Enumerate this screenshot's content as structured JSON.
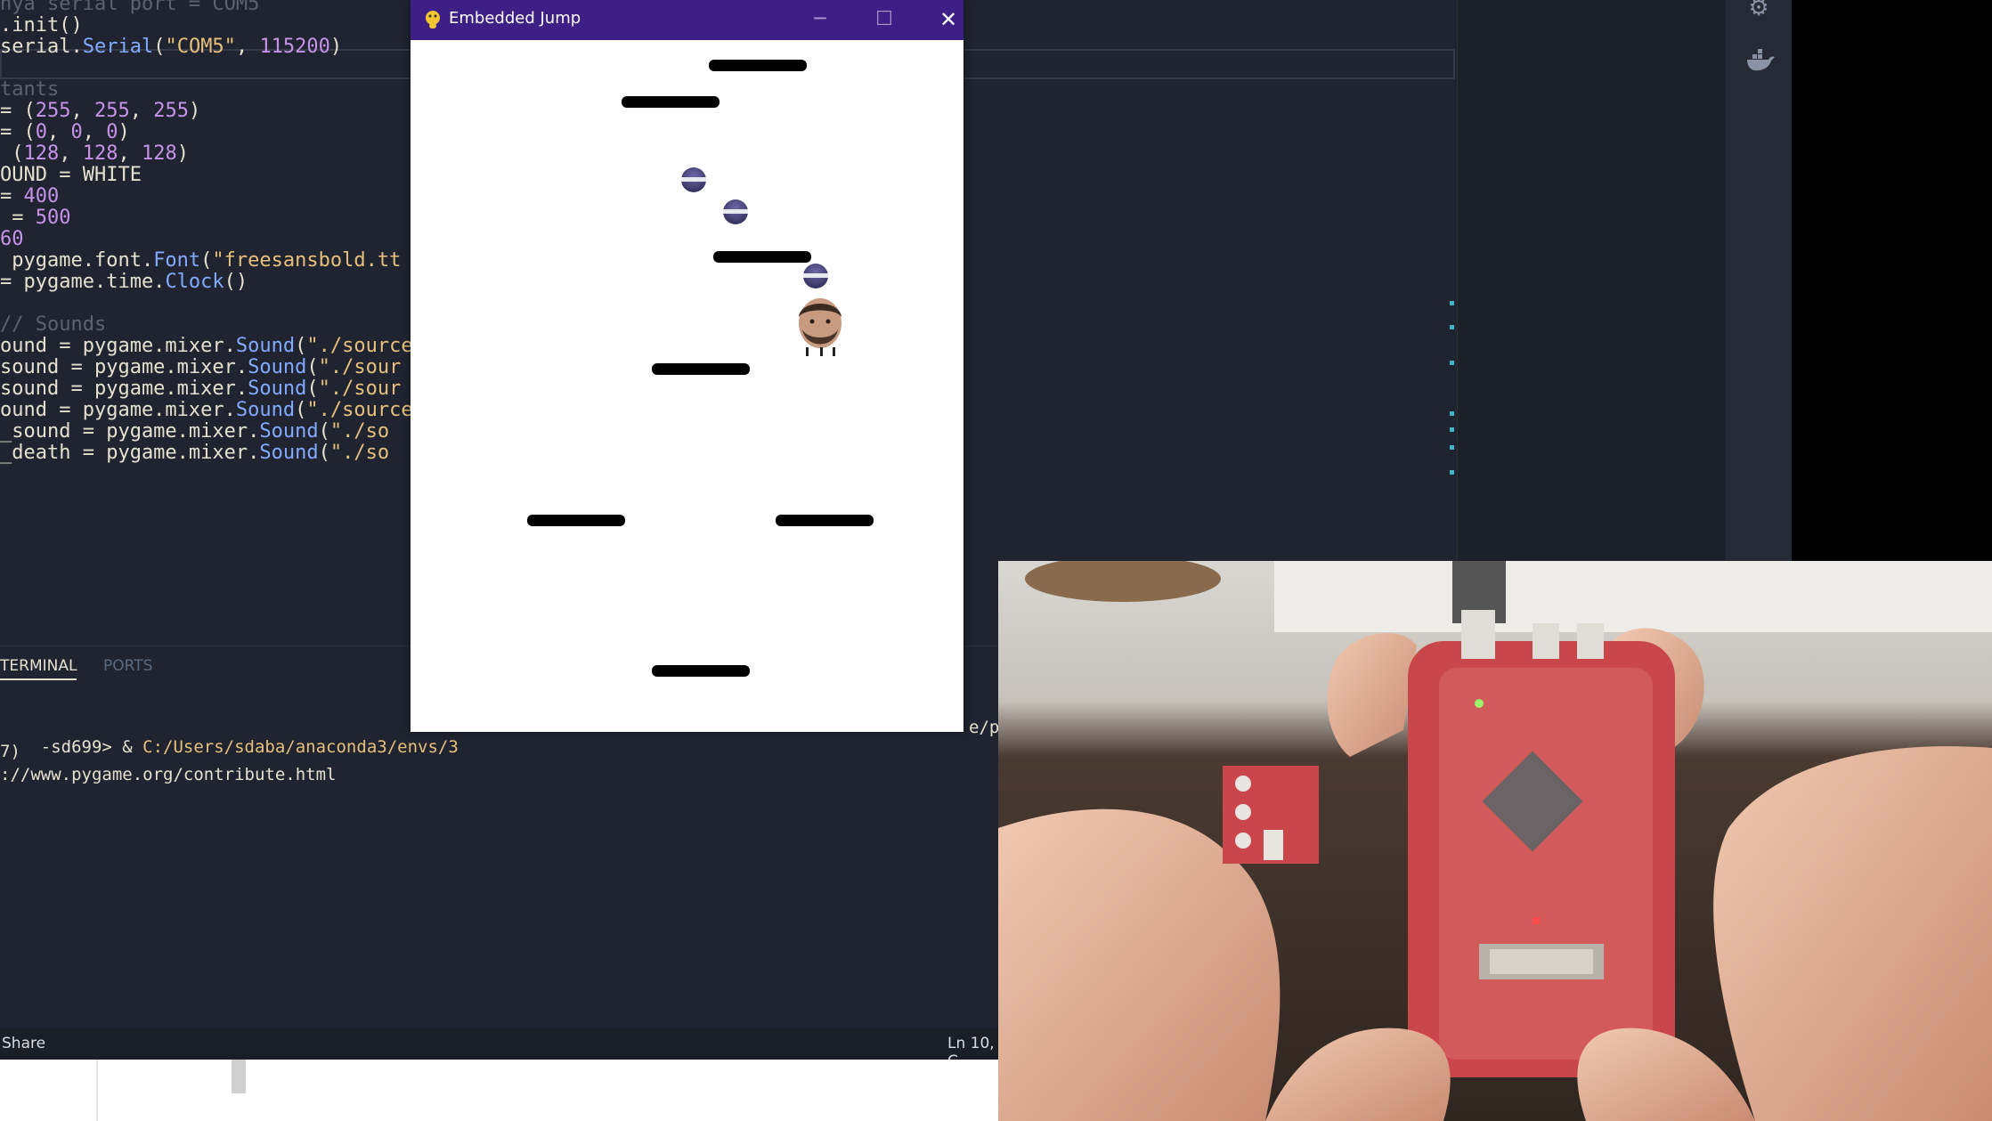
{
  "editor": {
    "code_lines": [
      {
        "parts": [
          {
            "t": "nya serial port = COM5",
            "c": "c-com"
          }
        ]
      },
      {
        "parts": [
          {
            "t": ".init()",
            "c": ""
          }
        ]
      },
      {
        "parts": [
          {
            "t": "serial.",
            "c": ""
          },
          {
            "t": "Serial",
            "c": "c-fn"
          },
          {
            "t": "(",
            "c": ""
          },
          {
            "t": "\"COM5\"",
            "c": "c-str"
          },
          {
            "t": ", ",
            "c": ""
          },
          {
            "t": "115200",
            "c": "c-num"
          },
          {
            "t": ")",
            "c": ""
          }
        ]
      },
      {
        "parts": [
          {
            "t": "",
            "c": ""
          }
        ]
      },
      {
        "parts": [
          {
            "t": "tants",
            "c": "c-com"
          }
        ]
      },
      {
        "parts": [
          {
            "t": "= (",
            "c": ""
          },
          {
            "t": "255",
            "c": "c-num"
          },
          {
            "t": ", ",
            "c": ""
          },
          {
            "t": "255",
            "c": "c-num"
          },
          {
            "t": ", ",
            "c": ""
          },
          {
            "t": "255",
            "c": "c-num"
          },
          {
            "t": ")",
            "c": ""
          }
        ]
      },
      {
        "parts": [
          {
            "t": "= (",
            "c": ""
          },
          {
            "t": "0",
            "c": "c-num"
          },
          {
            "t": ", ",
            "c": ""
          },
          {
            "t": "0",
            "c": "c-num"
          },
          {
            "t": ", ",
            "c": ""
          },
          {
            "t": "0",
            "c": "c-num"
          },
          {
            "t": ")",
            "c": ""
          }
        ]
      },
      {
        "parts": [
          {
            "t": " (",
            "c": ""
          },
          {
            "t": "128",
            "c": "c-num"
          },
          {
            "t": ", ",
            "c": ""
          },
          {
            "t": "128",
            "c": "c-num"
          },
          {
            "t": ", ",
            "c": ""
          },
          {
            "t": "128",
            "c": "c-num"
          },
          {
            "t": ")",
            "c": ""
          }
        ]
      },
      {
        "parts": [
          {
            "t": "OUND = WHITE",
            "c": ""
          }
        ]
      },
      {
        "parts": [
          {
            "t": "= ",
            "c": ""
          },
          {
            "t": "400",
            "c": "c-num"
          }
        ]
      },
      {
        "parts": [
          {
            "t": " = ",
            "c": ""
          },
          {
            "t": "500",
            "c": "c-num"
          }
        ]
      },
      {
        "parts": [
          {
            "t": "60",
            "c": "c-num"
          }
        ]
      },
      {
        "parts": [
          {
            "t": " pygame.font.",
            "c": ""
          },
          {
            "t": "Font",
            "c": "c-fn"
          },
          {
            "t": "(",
            "c": ""
          },
          {
            "t": "\"freesansbold.tt",
            "c": "c-str"
          }
        ]
      },
      {
        "parts": [
          {
            "t": "= pygame.time.",
            "c": ""
          },
          {
            "t": "Clock",
            "c": "c-fn"
          },
          {
            "t": "()",
            "c": ""
          }
        ]
      },
      {
        "parts": [
          {
            "t": "",
            "c": ""
          }
        ]
      },
      {
        "parts": [
          {
            "t": "// Sounds",
            "c": "c-com"
          }
        ]
      },
      {
        "parts": [
          {
            "t": "ound = pygame.mixer.",
            "c": ""
          },
          {
            "t": "Sound",
            "c": "c-fn"
          },
          {
            "t": "(",
            "c": ""
          },
          {
            "t": "\"./source",
            "c": "c-str"
          }
        ]
      },
      {
        "parts": [
          {
            "t": "sound = pygame.mixer.",
            "c": ""
          },
          {
            "t": "Sound",
            "c": "c-fn"
          },
          {
            "t": "(",
            "c": ""
          },
          {
            "t": "\"./sour",
            "c": "c-str"
          }
        ]
      },
      {
        "parts": [
          {
            "t": "sound = pygame.mixer.",
            "c": ""
          },
          {
            "t": "Sound",
            "c": "c-fn"
          },
          {
            "t": "(",
            "c": ""
          },
          {
            "t": "\"./sour",
            "c": "c-str"
          }
        ]
      },
      {
        "parts": [
          {
            "t": "ound = pygame.mixer.",
            "c": ""
          },
          {
            "t": "Sound",
            "c": "c-fn"
          },
          {
            "t": "(",
            "c": ""
          },
          {
            "t": "\"./source",
            "c": "c-str"
          }
        ]
      },
      {
        "parts": [
          {
            "t": "_sound = pygame.mixer.",
            "c": ""
          },
          {
            "t": "Sound",
            "c": "c-fn"
          },
          {
            "t": "(",
            "c": ""
          },
          {
            "t": "\"./so",
            "c": "c-str"
          }
        ]
      },
      {
        "parts": [
          {
            "t": "_death = pygame.mixer.",
            "c": ""
          },
          {
            "t": "Sound",
            "c": "c-fn"
          },
          {
            "t": "(",
            "c": ""
          },
          {
            "t": "\"./so",
            "c": "c-str"
          }
        ]
      }
    ]
  },
  "panel": {
    "tab_terminal": "TERMINAL",
    "tab_ports": "PORTS",
    "terminal_lines": [
      {
        "prefix": "-sd699> & ",
        "path": "C:/Users/sdaba/anaconda3/envs/3",
        "suffix": ""
      },
      {
        "prefix": "7)",
        "path": "",
        "suffix": ""
      },
      {
        "prefix": "://www.pygame.org/contribute.html",
        "path": "",
        "suffix": ""
      }
    ],
    "overflow_text": "e/p"
  },
  "statusbar": {
    "left": "Share",
    "right": "Ln 10, C"
  },
  "game": {
    "title": "Embedded Jump",
    "minimize": "─",
    "maximize": "☐",
    "close": "✕"
  },
  "icons": {
    "extension": "gear-icon",
    "docker": "docker-icon"
  },
  "colors": {
    "titlebar": "#3d1f86",
    "editor_bg": "#1f2430",
    "board_red": "#c9474a"
  }
}
